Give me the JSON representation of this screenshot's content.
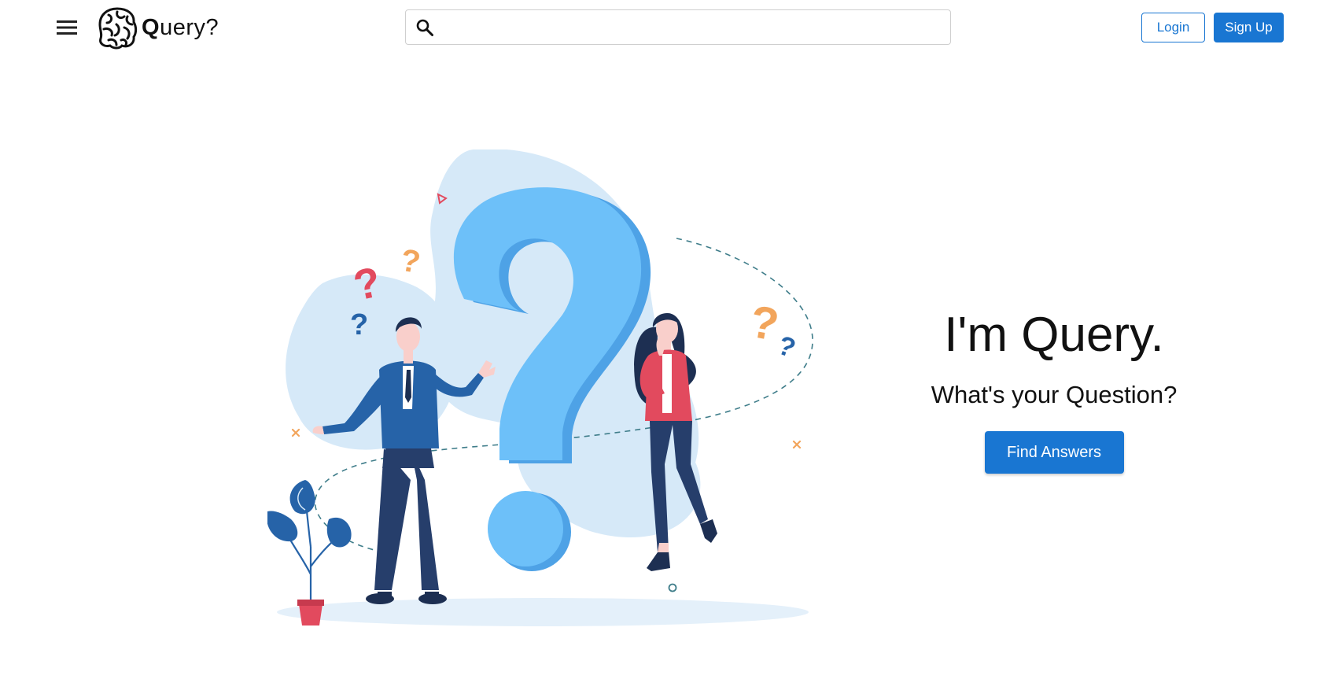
{
  "header": {
    "menu_icon": "hamburger-menu-icon",
    "logo": {
      "icon": "brain-icon",
      "text_first": "Q",
      "text_rest": "uery?"
    },
    "search": {
      "icon": "search-icon",
      "value": "",
      "placeholder": ""
    },
    "login_label": "Login",
    "signup_label": "Sign Up"
  },
  "hero": {
    "title": "I'm Query.",
    "subtitle": "What's your Question?",
    "cta_label": "Find Answers"
  },
  "colors": {
    "primary": "#1976d2",
    "illustration_blue": "#6dc0f9",
    "blob_light": "#d6e9f8",
    "suit_blue": "#2663a8",
    "pants_navy": "#263e6b",
    "accent_red": "#e24a5e",
    "accent_orange": "#f2a55c"
  }
}
